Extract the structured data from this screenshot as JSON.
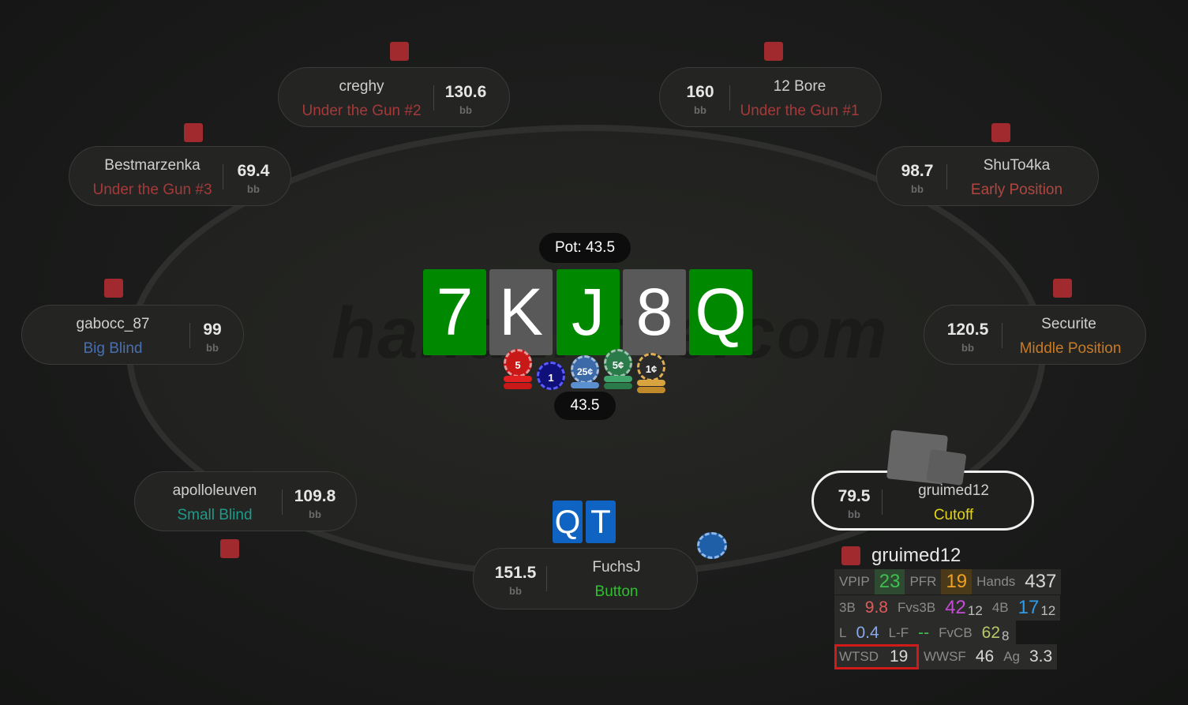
{
  "watermark": "hand2note.com",
  "pot": {
    "label": "Pot: 43.5",
    "amount": "43.5"
  },
  "board": [
    {
      "rank": "7",
      "color": "#008800"
    },
    {
      "rank": "K",
      "color": "#595959"
    },
    {
      "rank": "J",
      "color": "#008800"
    },
    {
      "rank": "8",
      "color": "#595959"
    },
    {
      "rank": "Q",
      "color": "#008800"
    }
  ],
  "chips": [
    "5",
    "1",
    "25¢",
    "5¢",
    "1¢"
  ],
  "hero_cards": [
    {
      "rank": "Q",
      "color": "#0f63c2"
    },
    {
      "rank": "T",
      "color": "#0f63c2"
    }
  ],
  "seats": {
    "creghy": {
      "name": "creghy",
      "position": "Under the Gun #2",
      "stack": "130.6",
      "unit": "bb",
      "pos_color": "#a5393a"
    },
    "twelve_bore": {
      "name": "12 Bore",
      "position": "Under the Gun #1",
      "stack": "160",
      "unit": "bb",
      "pos_color": "#a5393a"
    },
    "bestmarzenka": {
      "name": "Bestmarzenka",
      "position": "Under the Gun #3",
      "stack": "69.4",
      "unit": "bb",
      "pos_color": "#a5393a"
    },
    "shuto4ka": {
      "name": "ShuTo4ka",
      "position": "Early Position",
      "stack": "98.7",
      "unit": "bb",
      "pos_color": "#b2463f"
    },
    "gabocc": {
      "name": "gabocc_87",
      "position": "Big Blind",
      "stack": "99",
      "unit": "bb",
      "pos_color": "#4a6fb0"
    },
    "securite": {
      "name": "Securite",
      "position": "Middle Position",
      "stack": "120.5",
      "unit": "bb",
      "pos_color": "#c87a25"
    },
    "apolloleuven": {
      "name": "apolloleuven",
      "position": "Small Blind",
      "stack": "109.8",
      "unit": "bb",
      "pos_color": "#1f9a8a"
    },
    "gruimed12": {
      "name": "gruimed12",
      "position": "Cutoff",
      "stack": "79.5",
      "unit": "bb",
      "pos_color": "#e2d21a"
    },
    "fuchsj": {
      "name": "FuchsJ",
      "position": "Button",
      "stack": "151.5",
      "unit": "bb",
      "pos_color": "#2fbf2f"
    }
  },
  "hud": {
    "player": "gruimed12",
    "rows": [
      [
        {
          "label": "VPIP",
          "value": "23",
          "color": "#3fbf4f",
          "bg": "#2e4a30"
        },
        {
          "label": "PFR",
          "value": "19",
          "color": "#f0a020",
          "bg": "#4a3a1a"
        },
        {
          "label": "Hands",
          "value": "437",
          "color": "#d8d8d8"
        }
      ],
      [
        {
          "label": "3B",
          "value": "9.8",
          "color": "#e25a5a"
        },
        {
          "label": "Fvs3B",
          "value": "42",
          "sub": "12",
          "color": "#c34bd6"
        },
        {
          "label": "4B",
          "value": "17",
          "sub": "12",
          "color": "#2f9be8"
        }
      ],
      [
        {
          "label": "L",
          "value": "0.4",
          "color": "#8aa8e8"
        },
        {
          "label": "L-F",
          "value": "--",
          "color": "#3fbf4f"
        },
        {
          "label": "FvCB",
          "value": "62",
          "sub": "8",
          "color": "#b8c86a"
        }
      ],
      [
        {
          "label": "WTSD",
          "value": "19",
          "color": "#d8d8d8"
        },
        {
          "label": "WWSF",
          "value": "46",
          "color": "#d8d8d8"
        },
        {
          "label": "Ag",
          "value": "3.3",
          "color": "#d8d8d8"
        }
      ]
    ],
    "highlight_stat": "WTSD"
  }
}
